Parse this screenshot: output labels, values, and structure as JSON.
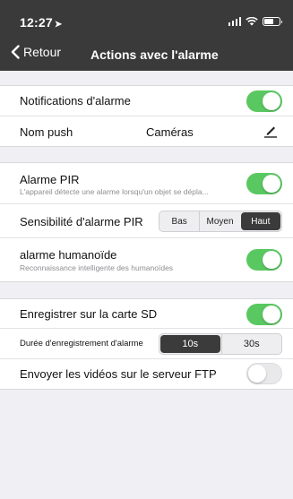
{
  "status": {
    "time": "12:27"
  },
  "nav": {
    "back_label": "Retour",
    "title": "Actions  avec l'alarme"
  },
  "group1": {
    "notifications": {
      "label": "Notifications d'alarme",
      "enabled": true
    },
    "push": {
      "label": "Nom push",
      "value": "Caméras"
    }
  },
  "group2": {
    "pir": {
      "label": "Alarme PIR",
      "subtitle": "L'appareil détecte une alarme lorsqu'un objet se dépla...",
      "enabled": true
    },
    "sensitivity": {
      "label": "Sensibilité d'alarme PIR",
      "options": [
        "Bas",
        "Moyen",
        "Haut"
      ],
      "selected": "Haut"
    },
    "humanoid": {
      "label": "alarme humanoïde",
      "subtitle": "Reconnaissance intelligente des humanoïdes",
      "enabled": true
    }
  },
  "group3": {
    "sd": {
      "label": "Enregistrer sur la carte SD",
      "enabled": true
    },
    "duration": {
      "label": "Durée d'enregistrement d'alarme",
      "options": [
        "10s",
        "30s"
      ],
      "selected": "10s"
    },
    "ftp": {
      "label": "Envoyer les vidéos sur le serveur FTP",
      "enabled": false
    }
  },
  "colors": {
    "toggle_on": "#5ac861",
    "header": "#3a3a3a",
    "background": "#efeff4"
  }
}
